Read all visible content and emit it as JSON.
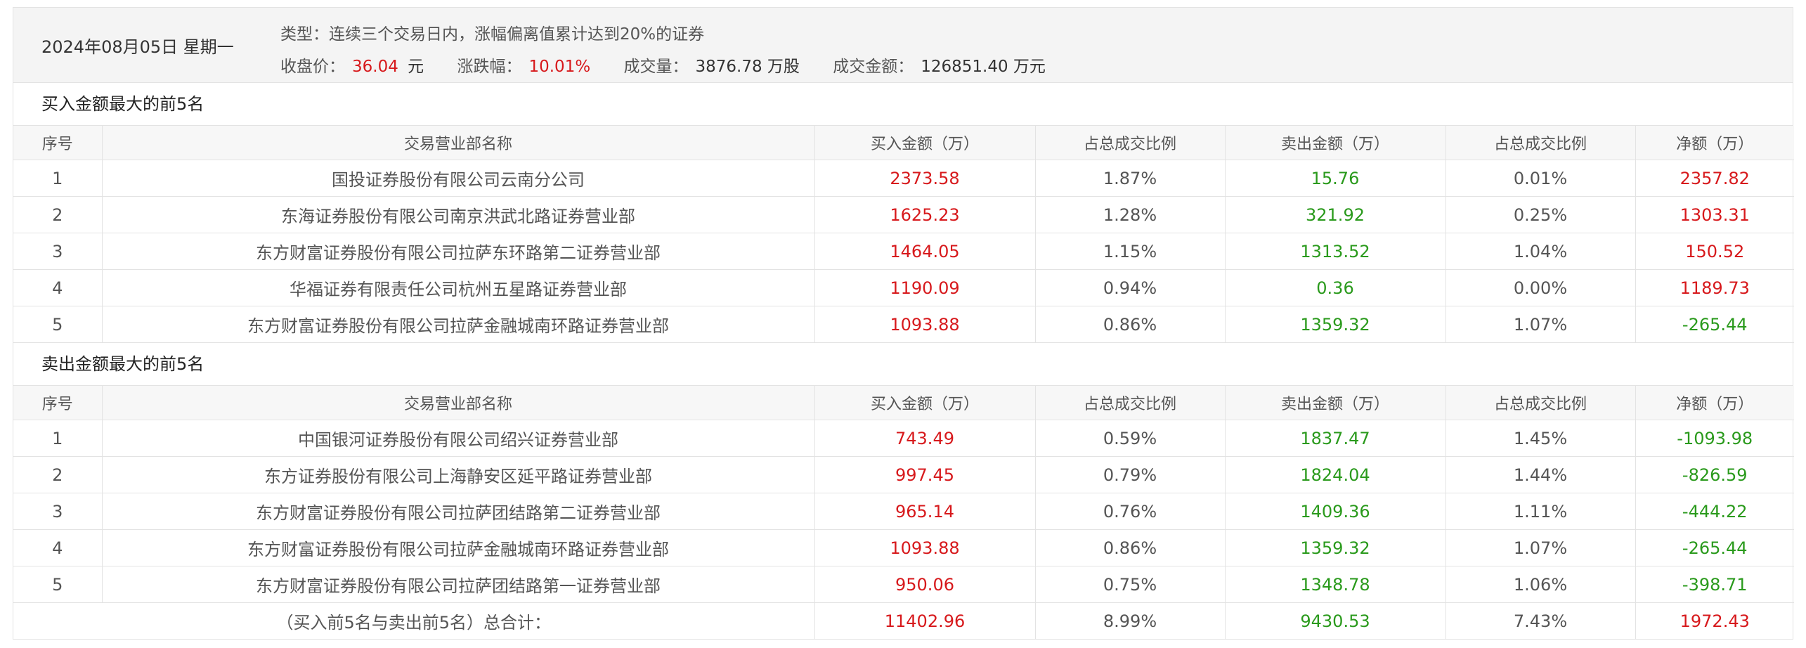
{
  "header": {
    "date": "2024年08月05日 星期一",
    "type_label": "类型：",
    "type_value": "连续三个交易日内，涨幅偏离值累计达到20%的证券",
    "close_label": "收盘价：",
    "close_value": "36.04",
    "close_unit": "元",
    "change_label": "涨跌幅：",
    "change_value": "10.01%",
    "volume_label": "成交量：",
    "volume_value": "3876.78 万股",
    "amount_label": "成交金额：",
    "amount_value": "126851.40 万元"
  },
  "columns": [
    "序号",
    "交易营业部名称",
    "买入金额（万）",
    "占总成交比例",
    "卖出金额（万）",
    "占总成交比例",
    "净额（万）"
  ],
  "buy_section": {
    "title": "买入金额最大的前5名",
    "rows": [
      {
        "no": "1",
        "name": "国投证券股份有限公司云南分公司",
        "buy": "2373.58",
        "buy_pct": "1.87%",
        "sell": "15.76",
        "sell_pct": "0.01%",
        "net": "2357.82"
      },
      {
        "no": "2",
        "name": "东海证券股份有限公司南京洪武北路证券营业部",
        "buy": "1625.23",
        "buy_pct": "1.28%",
        "sell": "321.92",
        "sell_pct": "0.25%",
        "net": "1303.31"
      },
      {
        "no": "3",
        "name": "东方财富证券股份有限公司拉萨东环路第二证券营业部",
        "buy": "1464.05",
        "buy_pct": "1.15%",
        "sell": "1313.52",
        "sell_pct": "1.04%",
        "net": "150.52"
      },
      {
        "no": "4",
        "name": "华福证券有限责任公司杭州五星路证券营业部",
        "buy": "1190.09",
        "buy_pct": "0.94%",
        "sell": "0.36",
        "sell_pct": "0.00%",
        "net": "1189.73"
      },
      {
        "no": "5",
        "name": "东方财富证券股份有限公司拉萨金融城南环路证券营业部",
        "buy": "1093.88",
        "buy_pct": "0.86%",
        "sell": "1359.32",
        "sell_pct": "1.07%",
        "net": "-265.44"
      }
    ]
  },
  "sell_section": {
    "title": "卖出金额最大的前5名",
    "rows": [
      {
        "no": "1",
        "name": "中国银河证券股份有限公司绍兴证券营业部",
        "buy": "743.49",
        "buy_pct": "0.59%",
        "sell": "1837.47",
        "sell_pct": "1.45%",
        "net": "-1093.98"
      },
      {
        "no": "2",
        "name": "东方证券股份有限公司上海静安区延平路证券营业部",
        "buy": "997.45",
        "buy_pct": "0.79%",
        "sell": "1824.04",
        "sell_pct": "1.44%",
        "net": "-826.59"
      },
      {
        "no": "3",
        "name": "东方财富证券股份有限公司拉萨团结路第二证券营业部",
        "buy": "965.14",
        "buy_pct": "0.76%",
        "sell": "1409.36",
        "sell_pct": "1.11%",
        "net": "-444.22"
      },
      {
        "no": "4",
        "name": "东方财富证券股份有限公司拉萨金融城南环路证券营业部",
        "buy": "1093.88",
        "buy_pct": "0.86%",
        "sell": "1359.32",
        "sell_pct": "1.07%",
        "net": "-265.44"
      },
      {
        "no": "5",
        "name": "东方财富证券股份有限公司拉萨团结路第一证券营业部",
        "buy": "950.06",
        "buy_pct": "0.75%",
        "sell": "1348.78",
        "sell_pct": "1.06%",
        "net": "-398.71"
      }
    ]
  },
  "total": {
    "label": "（买入前5名与卖出前5名）总合计：",
    "buy": "11402.96",
    "buy_pct": "8.99%",
    "sell": "9430.53",
    "sell_pct": "7.43%",
    "net": "1972.43"
  },
  "colors": {
    "positive": "#d7191c",
    "negative": "#2a9a1c"
  }
}
